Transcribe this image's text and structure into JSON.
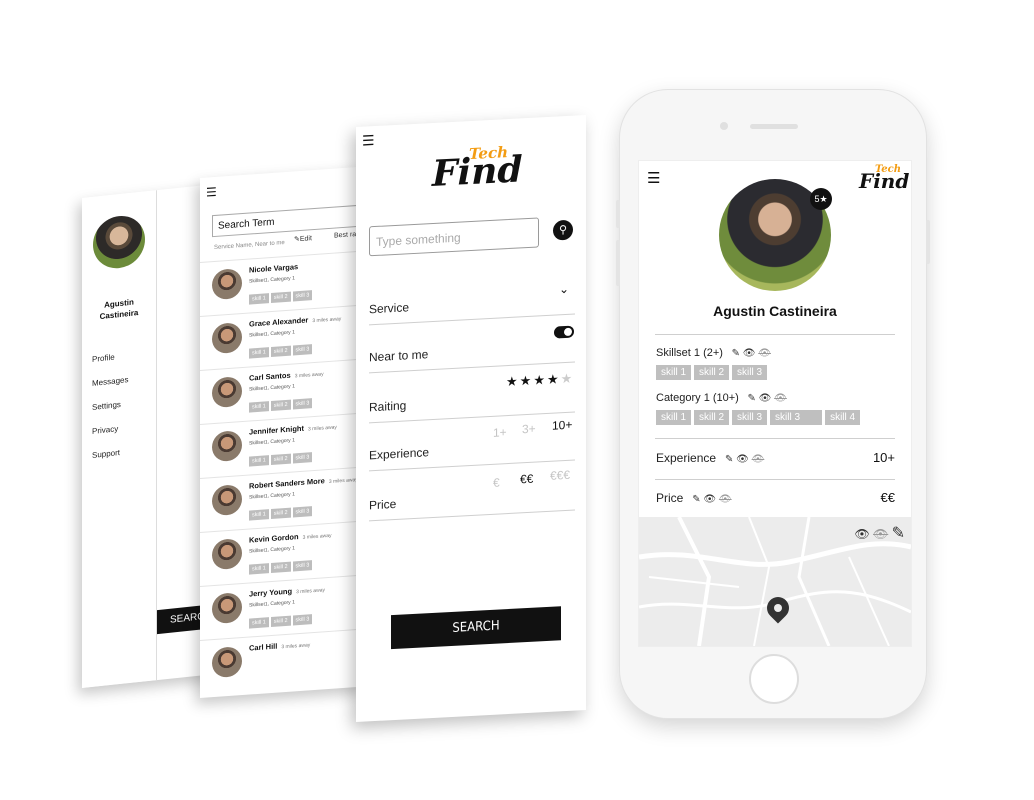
{
  "screen_menu": {
    "user_name": "Agustin\nCastineira",
    "menu": [
      "Profile",
      "Messages",
      "Settings",
      "Privacy",
      "Support"
    ],
    "search_button": "SEARCH"
  },
  "screen_results": {
    "search_placeholder": "Search Term",
    "hint": "Service Name, Near to me",
    "edit_label": "Edit",
    "sort_label": "Best ra",
    "results": [
      {
        "name": "Nicole Vargas",
        "distance": "",
        "sub": "Skillset1, Category 1",
        "skills": [
          "skill 1",
          "skill 2",
          "skill 3"
        ]
      },
      {
        "name": "Grace Alexander",
        "distance": "3 miles away",
        "sub": "Skillset1, Category 1",
        "skills": [
          "skill 1",
          "skill 2",
          "skill 3"
        ]
      },
      {
        "name": "Carl Santos",
        "distance": "3 miles away",
        "sub": "Skillset1, Category 1",
        "skills": [
          "skill 1",
          "skill 2",
          "skill 3"
        ]
      },
      {
        "name": "Jennifer Knight",
        "distance": "3 miles away",
        "sub": "Skillset1, Category 1",
        "skills": [
          "skill 1",
          "skill 2",
          "skill 3"
        ]
      },
      {
        "name": "Robert Sanders More",
        "distance": "3 miles away",
        "sub": "Skillset1, Category 1",
        "skills": [
          "skill 1",
          "skill 2",
          "skill 3"
        ]
      },
      {
        "name": "Kevin Gordon",
        "distance": "3 miles away",
        "sub": "Skillset1, Category 1",
        "skills": [
          "skill 1",
          "skill 2",
          "skill 3"
        ]
      },
      {
        "name": "Jerry Young",
        "distance": "3 miles away",
        "sub": "Skillset1, Category 1",
        "skills": [
          "skill 1",
          "skill 2",
          "skill 3"
        ]
      },
      {
        "name": "Carl Hill",
        "distance": "3 miles away",
        "sub": "",
        "skills": []
      }
    ]
  },
  "screen_filters": {
    "logo_tech": "Tech",
    "logo_find": "Find",
    "input_placeholder": "Type something",
    "service_label": "Service",
    "near_label": "Near to me",
    "rating_label": "Raiting",
    "rating_value": 4,
    "rating_max": 5,
    "experience_label": "Experience",
    "experience_options": [
      "1+",
      "3+",
      "10+"
    ],
    "price_label": "Price",
    "price_options": [
      "€",
      "€€",
      "€€€"
    ],
    "search_button": "SEARCH"
  },
  "phone_profile": {
    "logo_tech": "Tech",
    "logo_find": "Find",
    "badge": "5★",
    "name": "Agustin Castineira",
    "skillset_label": "Skillset 1 (2+)",
    "skillset_chips": [
      "skill 1",
      "skill 2",
      "skill 3"
    ],
    "category_label": "Category 1 (10+)",
    "category_chips": [
      "skill 1",
      "skill 2",
      "skill 3",
      "skill 3",
      "skill 4"
    ],
    "experience_label": "Experience",
    "experience_value": "10+",
    "price_label": "Price",
    "price_value": "€€"
  },
  "icons": [
    "menu-icon",
    "search-icon",
    "chevron-down-icon",
    "toggle-icon",
    "star-icon",
    "pencil-icon",
    "eye-icon",
    "eye-off-icon",
    "map-pin-icon"
  ],
  "colors": {
    "accent": "#f39c12",
    "dark": "#111111",
    "chip": "#bfbfbf"
  }
}
